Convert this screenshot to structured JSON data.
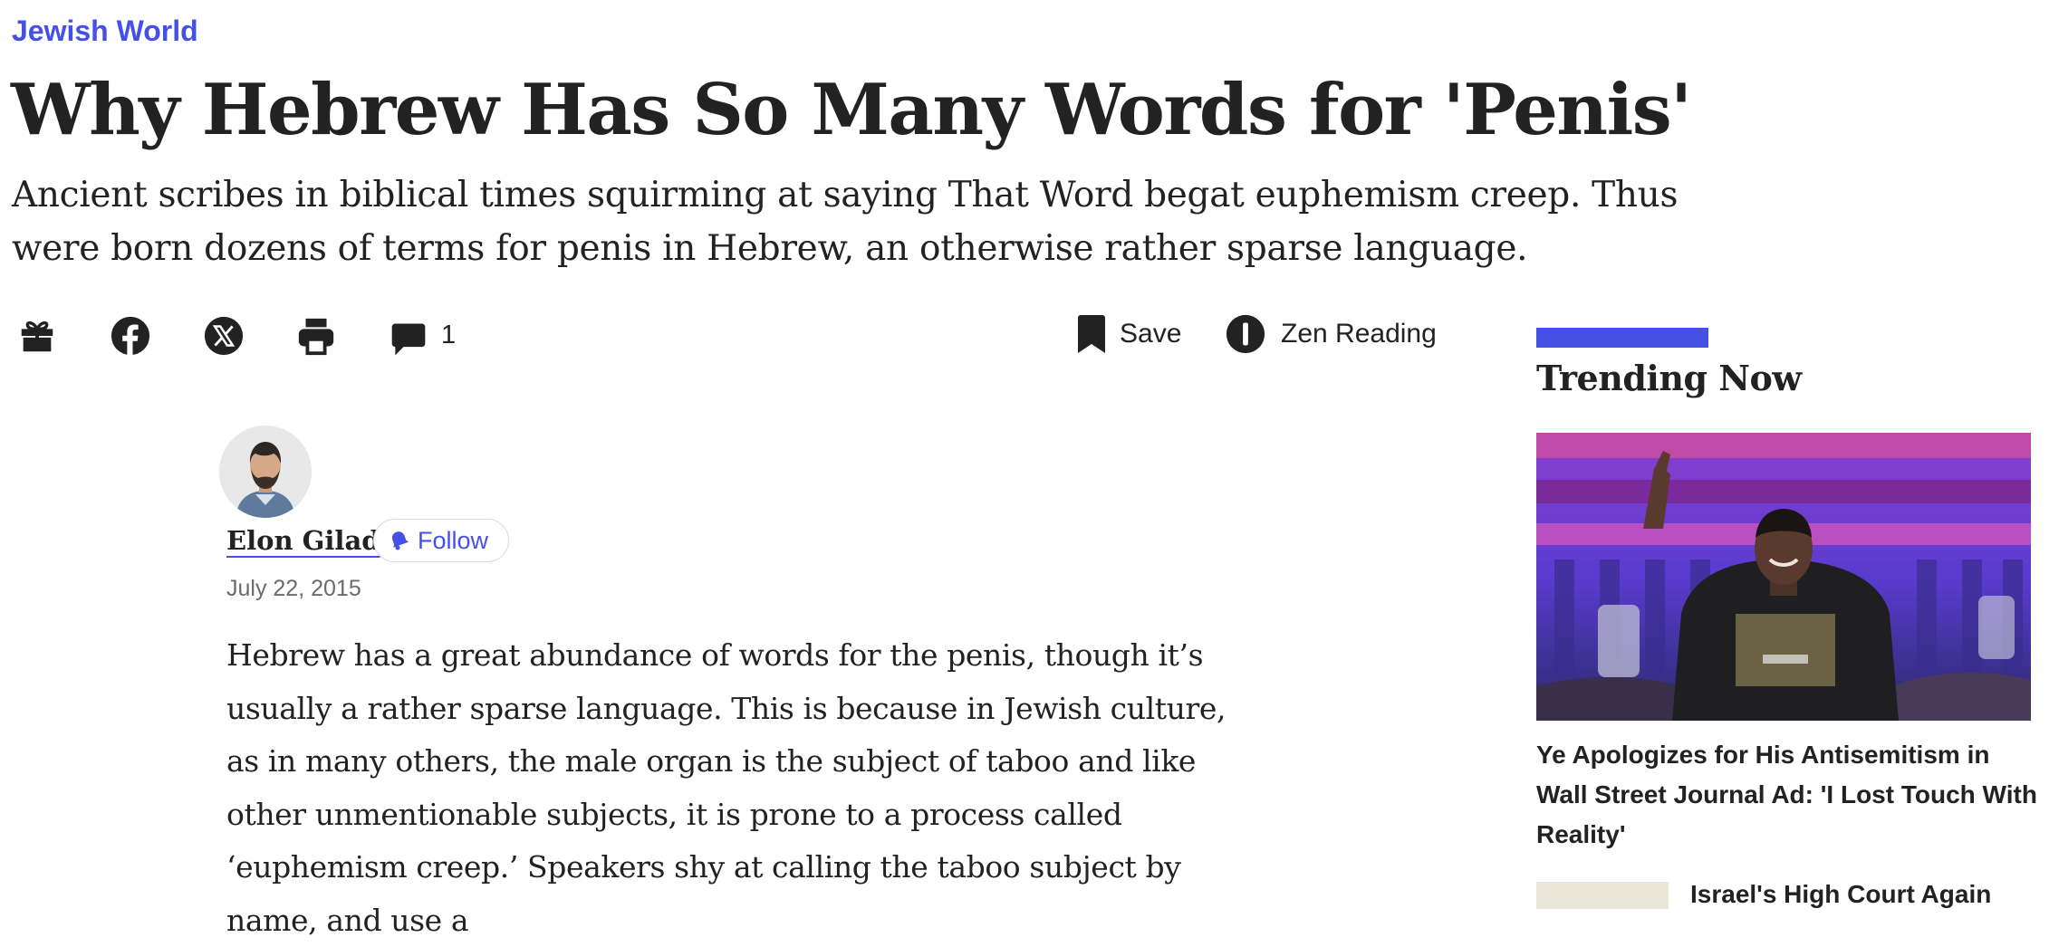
{
  "article": {
    "section": "Jewish World",
    "title": "Why Hebrew Has So Many Words for 'Penis'",
    "subtitle": "Ancient scribes in biblical times squirming at saying That Word begat euphemism creep. Thus were born dozens of terms for penis in Hebrew, an otherwise rather sparse language.",
    "author": "Elon Gilad",
    "follow_label": "Follow",
    "date": "July 22, 2015",
    "body_preview": "Hebrew has a great abundance of words for the penis, though it’s usually a rather sparse language. This is because in Jewish culture, as in many others, the male organ is the subject of taboo and like other unmentionable subjects, it is prone to a process called ‘euphemism creep.’ Speakers shy at calling the taboo subject by name, and use a"
  },
  "toolbar": {
    "icons": [
      "gift-icon",
      "facebook-icon",
      "x-icon",
      "print-icon",
      "comment-icon"
    ],
    "comments_count": "1",
    "save_label": "Save",
    "zen_label": "Zen Reading"
  },
  "sidebar": {
    "heading": "Trending Now",
    "items": [
      {
        "headline": "Ye Apologizes for His Antisemitism in Wall Street Journal Ad: 'I Lost Touch With Reality'"
      },
      {
        "headline": "Israel's High Court Again"
      }
    ]
  },
  "colors": {
    "accent": "#4550e6",
    "text": "#222222",
    "muted": "#6b6b6b"
  }
}
